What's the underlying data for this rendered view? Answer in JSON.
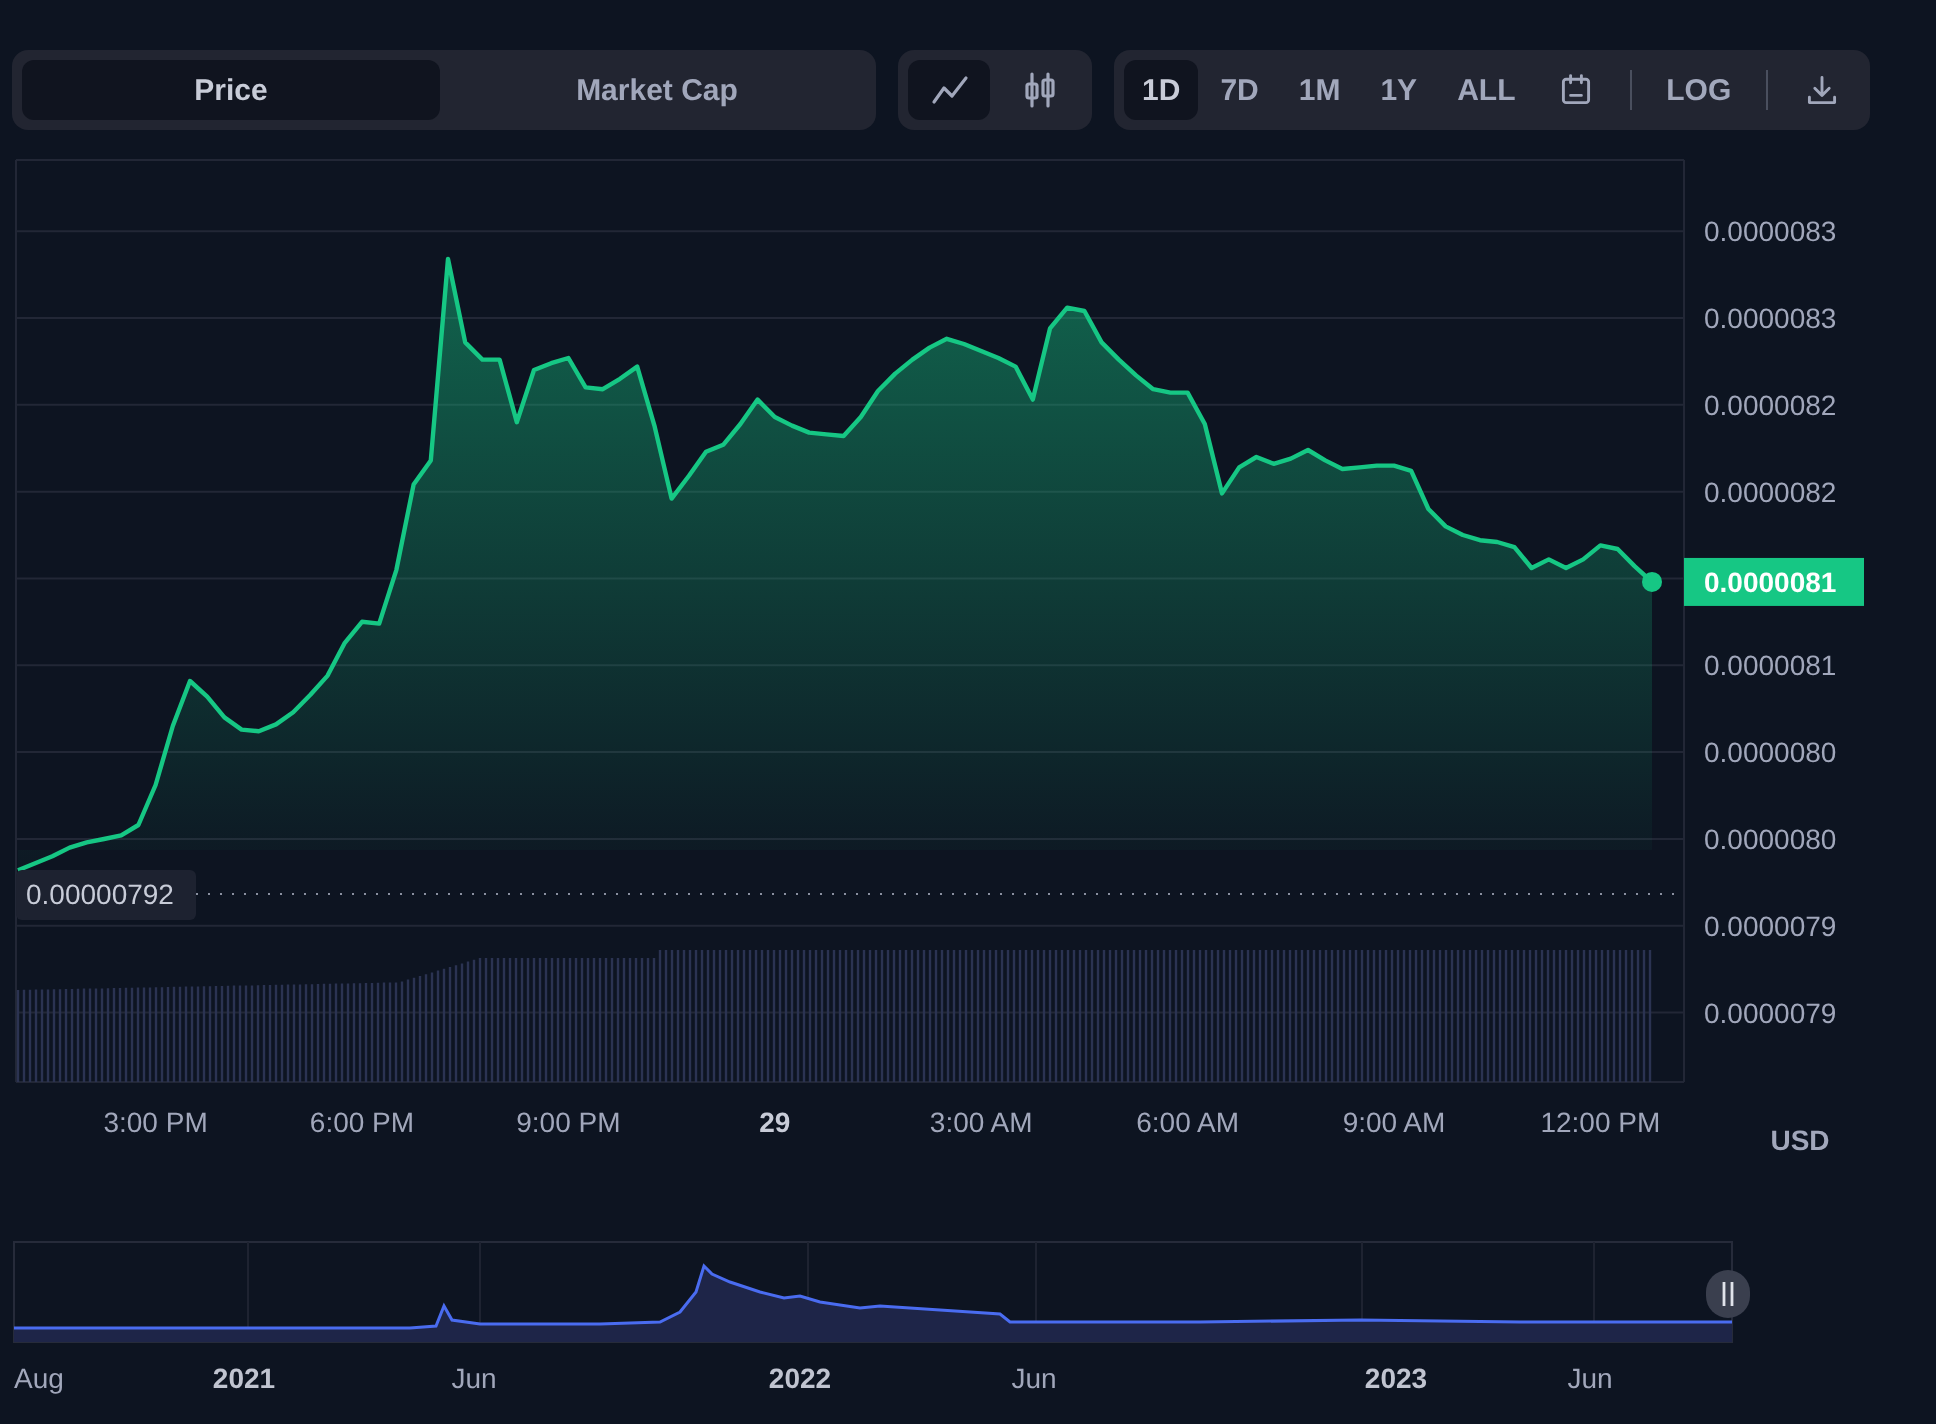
{
  "toolbar": {
    "metric_tabs": [
      {
        "label": "Price",
        "selected": true
      },
      {
        "label": "Market Cap",
        "selected": false
      }
    ],
    "chart_types": [
      {
        "kind": "line",
        "selected": true
      },
      {
        "kind": "candles",
        "selected": false
      }
    ],
    "range": [
      {
        "kind": "range",
        "label": "1D",
        "selected": true
      },
      {
        "kind": "range",
        "label": "7D",
        "selected": false
      },
      {
        "kind": "range",
        "label": "1M",
        "selected": false
      },
      {
        "kind": "range",
        "label": "1Y",
        "selected": false
      },
      {
        "kind": "range",
        "label": "ALL",
        "selected": false
      },
      {
        "kind": "calendar"
      },
      {
        "kind": "toggle",
        "label": "LOG"
      },
      {
        "kind": "download"
      }
    ]
  },
  "price_chart": {
    "chart_data": {
      "type": "line",
      "grid": true,
      "ylim": [
        7.81e-06,
        8.341e-06
      ],
      "categories": [
        null,
        null,
        null,
        null,
        null,
        null,
        null,
        null,
        "3:00 PM",
        null,
        null,
        null,
        null,
        null,
        null,
        null,
        null,
        null,
        null,
        null,
        "6:00 PM",
        null,
        null,
        null,
        null,
        null,
        null,
        null,
        null,
        null,
        null,
        null,
        "9:00 PM",
        null,
        null,
        null,
        null,
        null,
        null,
        null,
        null,
        null,
        null,
        null,
        "29",
        null,
        null,
        null,
        null,
        null,
        null,
        null,
        null,
        null,
        null,
        null,
        "3:00 AM",
        null,
        null,
        null,
        null,
        null,
        null,
        null,
        null,
        null,
        null,
        null,
        "6:00 AM",
        null,
        null,
        null,
        null,
        null,
        null,
        null,
        null,
        null,
        null,
        null,
        "9:00 AM",
        null,
        null,
        null,
        null,
        null,
        null,
        null,
        null,
        null,
        null,
        null,
        "12:00 PM",
        null,
        null,
        null
      ],
      "series": [
        {
          "color": "#16c784",
          "values": [
            7.932e-06,
            7.936e-06,
            7.94e-06,
            7.945e-06,
            7.948e-06,
            7.95e-06,
            7.952e-06,
            7.958e-06,
            7.981e-06,
            8.015e-06,
            8.041e-06,
            8.032e-06,
            8.02e-06,
            8.013e-06,
            8.012e-06,
            8.016e-06,
            8.023e-06,
            8.033e-06,
            8.044e-06,
            8.063e-06,
            8.075e-06,
            8.074e-06,
            8.105e-06,
            8.154e-06,
            8.168e-06,
            8.284e-06,
            8.236e-06,
            8.226e-06,
            8.226e-06,
            8.19e-06,
            8.22e-06,
            8.224e-06,
            8.227e-06,
            8.21e-06,
            8.209e-06,
            8.215e-06,
            8.222e-06,
            8.188e-06,
            8.146e-06,
            8.159e-06,
            8.173e-06,
            8.177e-06,
            8.189e-06,
            8.203e-06,
            8.193e-06,
            8.188e-06,
            8.184e-06,
            8.183e-06,
            8.182e-06,
            8.193e-06,
            8.208e-06,
            8.218e-06,
            8.226e-06,
            8.233e-06,
            8.238e-06,
            8.235e-06,
            8.231e-06,
            8.227e-06,
            8.222e-06,
            8.203e-06,
            8.244e-06,
            8.256e-06,
            8.254e-06,
            8.236e-06,
            8.226e-06,
            8.217e-06,
            8.209e-06,
            8.207e-06,
            8.207e-06,
            8.189e-06,
            8.149e-06,
            8.164e-06,
            8.17e-06,
            8.166e-06,
            8.169e-06,
            8.174e-06,
            8.168e-06,
            8.163e-06,
            8.164e-06,
            8.165e-06,
            8.165e-06,
            8.162e-06,
            8.14e-06,
            8.13e-06,
            8.125e-06,
            8.122e-06,
            8.121e-06,
            8.118e-06,
            8.106e-06,
            8.111e-06,
            8.106e-06,
            8.111e-06,
            8.119e-06,
            8.117e-06,
            8.107e-06,
            8.098e-06
          ]
        }
      ],
      "yticks": [
        {
          "value": 8.3e-06,
          "label": "0.0000083"
        },
        {
          "value": 8.25e-06,
          "label": "0.0000083"
        },
        {
          "value": 8.2e-06,
          "label": "0.0000082"
        },
        {
          "value": 8.15e-06,
          "label": "0.0000082"
        },
        {
          "value": 8.05e-06,
          "label": "0.0000081"
        },
        {
          "value": 8e-06,
          "label": "0.0000080"
        },
        {
          "value": 7.95e-06,
          "label": "0.0000080"
        },
        {
          "value": 7.9e-06,
          "label": "0.0000079"
        },
        {
          "value": 7.85e-06,
          "label": "0.0000079"
        }
      ]
    },
    "current_price": "0.0000081",
    "low_price": "0.00000792",
    "currency": "USD"
  },
  "navigator": {
    "labels": [
      {
        "text": "Aug",
        "kind": "month"
      },
      {
        "text": "2021",
        "kind": "year"
      },
      {
        "text": "Jun",
        "kind": "month"
      },
      {
        "text": "2022",
        "kind": "year"
      },
      {
        "text": "Jun",
        "kind": "month"
      },
      {
        "text": "2023",
        "kind": "year"
      },
      {
        "text": "Jun",
        "kind": "month"
      }
    ]
  }
}
